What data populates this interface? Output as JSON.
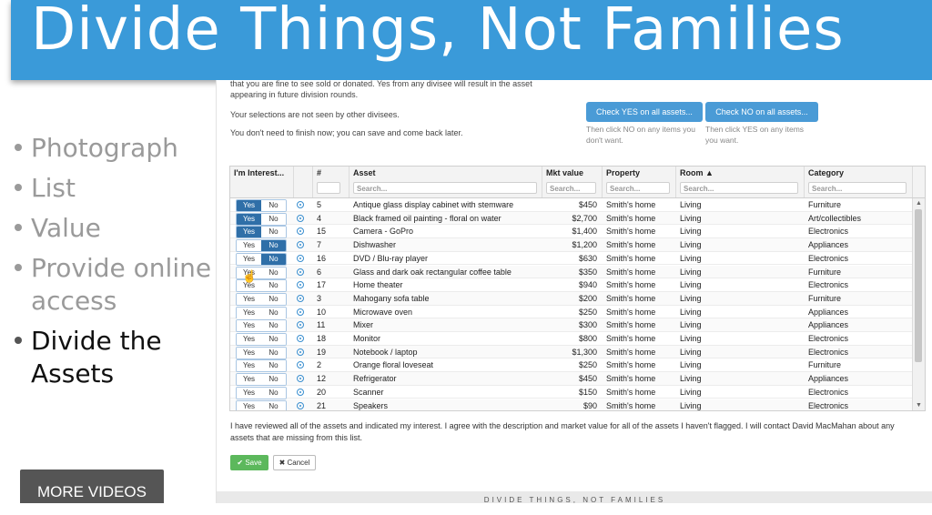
{
  "banner": {
    "title": "Divide Things, Not Families"
  },
  "bullets": [
    {
      "label": "Photograph",
      "active": false
    },
    {
      "label": "List",
      "active": false
    },
    {
      "label": "Value",
      "active": false
    },
    {
      "label": "Provide online access",
      "active": false
    },
    {
      "label": "Divide the Assets",
      "active": true
    }
  ],
  "more_videos": "MORE VIDEOS",
  "instructions": {
    "line1": "that you are fine to see sold or donated. Yes from any divisee will result in the asset",
    "line2": "appearing in future division rounds.",
    "line3": "Your selections are not seen by other divisees.",
    "line4": "You don't need to finish now; you can save and come back later."
  },
  "actions": {
    "check_yes": "Check YES on all assets...",
    "check_yes_hint": "Then click NO on any items you don't want.",
    "check_no": "Check NO on all assets...",
    "check_no_hint": "Then click YES on any items you want."
  },
  "grid": {
    "columns": {
      "interest": "I'm Interest...",
      "num": "#",
      "asset": "Asset",
      "value": "Mkt value",
      "property": "Property",
      "room": "Room ▲",
      "category": "Category"
    },
    "search_placeholder": "Search...",
    "toggle_yes": "Yes",
    "toggle_no": "No",
    "rows": [
      {
        "selected": "yes",
        "num": "5",
        "asset": "Antique glass display cabinet with stemware",
        "value": "$450",
        "property": "Smith's home",
        "room": "Living",
        "category": "Furniture"
      },
      {
        "selected": "yes",
        "num": "4",
        "asset": "Black framed oil painting - floral on water",
        "value": "$2,700",
        "property": "Smith's home",
        "room": "Living",
        "category": "Art/collectibles"
      },
      {
        "selected": "yes",
        "num": "15",
        "asset": "Camera - GoPro",
        "value": "$1,400",
        "property": "Smith's home",
        "room": "Living",
        "category": "Electronics"
      },
      {
        "selected": "no",
        "num": "7",
        "asset": "Dishwasher",
        "value": "$1,200",
        "property": "Smith's home",
        "room": "Living",
        "category": "Appliances"
      },
      {
        "selected": "no",
        "num": "16",
        "asset": "DVD / Blu-ray player",
        "value": "$630",
        "property": "Smith's home",
        "room": "Living",
        "category": "Electronics"
      },
      {
        "selected": "none",
        "num": "6",
        "asset": "Glass and dark oak rectangular coffee table",
        "value": "$350",
        "property": "Smith's home",
        "room": "Living",
        "category": "Furniture"
      },
      {
        "selected": "none",
        "num": "17",
        "asset": "Home theater",
        "value": "$940",
        "property": "Smith's home",
        "room": "Living",
        "category": "Electronics"
      },
      {
        "selected": "none",
        "num": "3",
        "asset": "Mahogany sofa table",
        "value": "$200",
        "property": "Smith's home",
        "room": "Living",
        "category": "Furniture"
      },
      {
        "selected": "none",
        "num": "10",
        "asset": "Microwave oven",
        "value": "$250",
        "property": "Smith's home",
        "room": "Living",
        "category": "Appliances"
      },
      {
        "selected": "none",
        "num": "11",
        "asset": "Mixer",
        "value": "$300",
        "property": "Smith's home",
        "room": "Living",
        "category": "Appliances"
      },
      {
        "selected": "none",
        "num": "18",
        "asset": "Monitor",
        "value": "$800",
        "property": "Smith's home",
        "room": "Living",
        "category": "Electronics"
      },
      {
        "selected": "none",
        "num": "19",
        "asset": "Notebook / laptop",
        "value": "$1,300",
        "property": "Smith's home",
        "room": "Living",
        "category": "Electronics"
      },
      {
        "selected": "none",
        "num": "2",
        "asset": "Orange floral loveseat",
        "value": "$250",
        "property": "Smith's home",
        "room": "Living",
        "category": "Furniture"
      },
      {
        "selected": "none",
        "num": "12",
        "asset": "Refrigerator",
        "value": "$450",
        "property": "Smith's home",
        "room": "Living",
        "category": "Appliances"
      },
      {
        "selected": "none",
        "num": "20",
        "asset": "Scanner",
        "value": "$150",
        "property": "Smith's home",
        "room": "Living",
        "category": "Electronics"
      },
      {
        "selected": "none",
        "num": "21",
        "asset": "Speakers",
        "value": "$90",
        "property": "Smith's home",
        "room": "Living",
        "category": "Electronics"
      }
    ]
  },
  "agreement": "I have reviewed all of the assets and indicated my interest. I agree with the description and market value for all of the assets I haven't flagged. I will contact David MacMahan about any assets that are missing from this list.",
  "buttons": {
    "save": "✔ Save",
    "cancel": "✖ Cancel"
  },
  "footer": "DIVIDE THINGS, NOT FAMILIES",
  "colors": {
    "banner": "#3a9ad9",
    "primary_button": "#4a9bd6",
    "toggle_on": "#2f6fa8",
    "save": "#5cb85c"
  }
}
